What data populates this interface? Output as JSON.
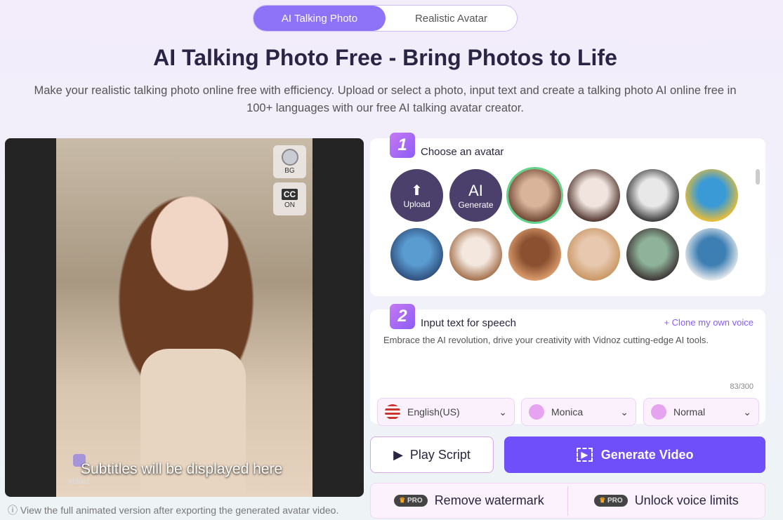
{
  "tabs": [
    {
      "label": "AI Talking Photo",
      "active": true
    },
    {
      "label": "Realistic Avatar",
      "active": false
    }
  ],
  "title": "AI Talking Photo Free - Bring Photos to Life",
  "subtitle": "Make your realistic talking photo online free with efficiency. Upload or select a photo, input text and create a talking photo AI online free in 100+ languages with our free AI talking avatar creator.",
  "preview": {
    "bg_label": "BG",
    "cc_label": "CC",
    "cc_state": "ON",
    "subtitle_placeholder": "Subtitles will be displayed here",
    "watermark": "Vidnoz",
    "note": "View the full animated version after exporting the generated avatar video."
  },
  "step1": {
    "number": "1",
    "title": "Choose an avatar",
    "upload_label": "Upload",
    "ai_label": "AI",
    "generate_label": "Generate",
    "avatars": [
      {
        "colors": [
          "#d9b49a",
          "#6b4330"
        ]
      },
      {
        "colors": [
          "#f1e4de",
          "#4a3028"
        ]
      },
      {
        "colors": [
          "#e8e8e8",
          "#333"
        ]
      },
      {
        "colors": [
          "#3a9ad6",
          "#f2c02f"
        ]
      },
      {
        "colors": [
          "#5a9bd0",
          "#2d4c7a"
        ]
      },
      {
        "colors": [
          "#f3e7de",
          "#a06a44"
        ]
      },
      {
        "colors": [
          "#8a5030",
          "#e0a070"
        ]
      },
      {
        "colors": [
          "#e8c9b0",
          "#c89460"
        ]
      },
      {
        "colors": [
          "#8fb39a",
          "#3a3030"
        ]
      },
      {
        "colors": [
          "#3e7fb3",
          "#f0f0f0"
        ]
      }
    ]
  },
  "step2": {
    "number": "2",
    "title": "Input text for speech",
    "clone_label": "+ Clone my own voice",
    "text": "Embrace the AI revolution, drive your creativity with Vidnoz cutting-edge AI tools.",
    "count": "83/300",
    "language": "English(US)",
    "voice": "Monica",
    "emotion": "Normal"
  },
  "actions": {
    "play": "Play Script",
    "generate": "Generate Video"
  },
  "pro": {
    "tag": "PRO",
    "remove_watermark": "Remove watermark",
    "unlock_voice": "Unlock voice limits"
  },
  "colors": {
    "accent": "#6f4ff9",
    "tab_active": "#8e72f8"
  }
}
